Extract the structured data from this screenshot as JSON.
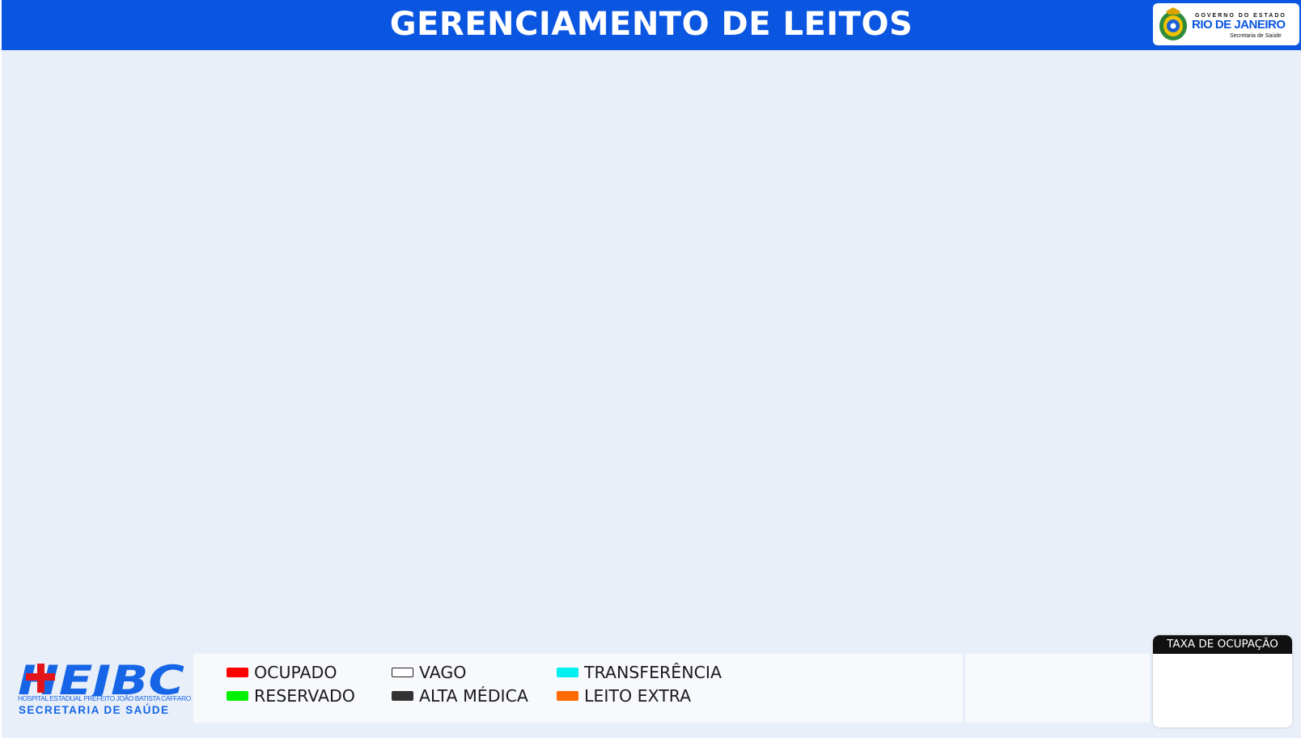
{
  "header": {
    "title": "GERENCIAMENTO DE LEITOS",
    "background_color": "#0a56e1"
  },
  "gov_logo": {
    "line_small": "GOVERNO DO ESTADO",
    "line_main": "RIO DE JANEIRO",
    "line_sub": "Secretaria de Saúde"
  },
  "hospital_logo": {
    "mark": "HEJBC",
    "full_name": "HOSPITAL ESTADUAL PREFEITO JOÃO BATISTA CAFFARO",
    "department": "SECRETARIA DE SAÚDE",
    "brand_color": "#1565e6",
    "cross_color": "#e3151b"
  },
  "legend": {
    "items": [
      {
        "label": "OCUPADO",
        "color": "#ff0000"
      },
      {
        "label": "RESERVADO",
        "color": "#00f000"
      },
      {
        "label": "VAGO",
        "color": "#ffffff"
      },
      {
        "label": "ALTA MÉDICA",
        "color": "#333333"
      },
      {
        "label": "TRANSFERÊNCIA",
        "color": "#00f0f0"
      },
      {
        "label": "LEITO EXTRA",
        "color": "#ff6a00"
      }
    ]
  },
  "taxa_ocupacao": {
    "title": "TAXA DE OCUPAÇÃO",
    "value": ""
  }
}
